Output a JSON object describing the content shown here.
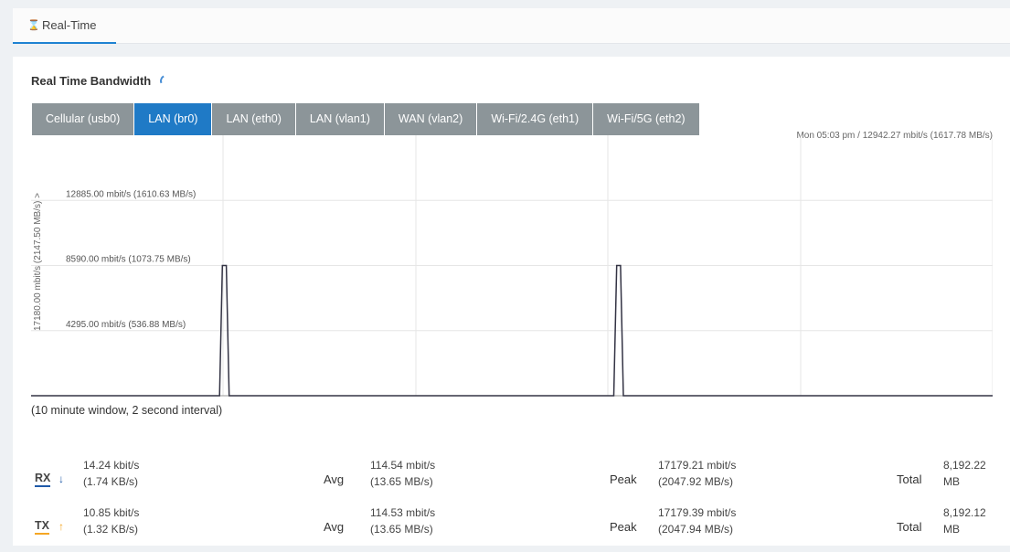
{
  "top_tab": {
    "icon": "hourglass-icon",
    "label": "Real-Time"
  },
  "section_title": "Real Time Bandwidth",
  "iface_tabs": [
    {
      "label": "Cellular (usb0)",
      "active": false
    },
    {
      "label": "LAN (br0)",
      "active": true
    },
    {
      "label": "LAN (eth0)",
      "active": false
    },
    {
      "label": "LAN (vlan1)",
      "active": false
    },
    {
      "label": "WAN (vlan2)",
      "active": false
    },
    {
      "label": "Wi-Fi/2.4G (eth1)",
      "active": false
    },
    {
      "label": "Wi-Fi/5G (eth2)",
      "active": false
    }
  ],
  "status_line": "Mon 05:03 pm / 12942.27 mbit/s (1617.78 MB/s)",
  "y_axis_label": "17180.00 mbit/s (2147.50 MB/s) >",
  "window_note": "(10 minute window, 2 second interval)",
  "chart_data": {
    "type": "line",
    "y_max": 17180,
    "ylim": [
      0,
      17180
    ],
    "gridlines": [
      {
        "value": 12885,
        "label": "12885.00 mbit/s (1610.63 MB/s)"
      },
      {
        "value": 8590,
        "label": "8590.00 mbit/s (1073.75 MB/s)"
      },
      {
        "value": 4295,
        "label": "4295.00 mbit/s (536.88 MB/s)"
      }
    ],
    "vertical_grid_count": 5,
    "series": [
      {
        "values_mbit_per_s": [
          {
            "t": 0.196,
            "v": 0
          },
          {
            "t": 0.199,
            "v": 8590
          },
          {
            "t": 0.203,
            "v": 8590
          },
          {
            "t": 0.206,
            "v": 0
          },
          {
            "t": 0.606,
            "v": 0
          },
          {
            "t": 0.609,
            "v": 8590
          },
          {
            "t": 0.613,
            "v": 8590
          },
          {
            "t": 0.616,
            "v": 0
          }
        ]
      }
    ],
    "colors": {
      "line": "#334",
      "grid": "#e6e6e6",
      "axis": "#999"
    }
  },
  "stats": {
    "rx": {
      "label": "RX",
      "arrow": "↓",
      "current1": "14.24 kbit/s",
      "current2": "(1.74 KB/s)",
      "avg_label": "Avg",
      "avg1": "114.54 mbit/s",
      "avg2": "(13.65 MB/s)",
      "peak_label": "Peak",
      "peak1": "17179.21 mbit/s",
      "peak2": "(2047.92 MB/s)",
      "total_label": "Total",
      "total1": "8,192.22",
      "total2": "MB"
    },
    "tx": {
      "label": "TX",
      "arrow": "↑",
      "current1": "10.85 kbit/s",
      "current2": "(1.32 KB/s)",
      "avg_label": "Avg",
      "avg1": "114.53 mbit/s",
      "avg2": "(13.65 MB/s)",
      "peak_label": "Peak",
      "peak1": "17179.39 mbit/s",
      "peak2": "(2047.94 MB/s)",
      "total_label": "Total",
      "total1": "8,192.12",
      "total2": "MB"
    }
  },
  "colors": {
    "accent": "#1f7ac6",
    "tab_inactive": "#8c9599",
    "rx": "#1f5aa8",
    "tx": "#f5a623"
  }
}
